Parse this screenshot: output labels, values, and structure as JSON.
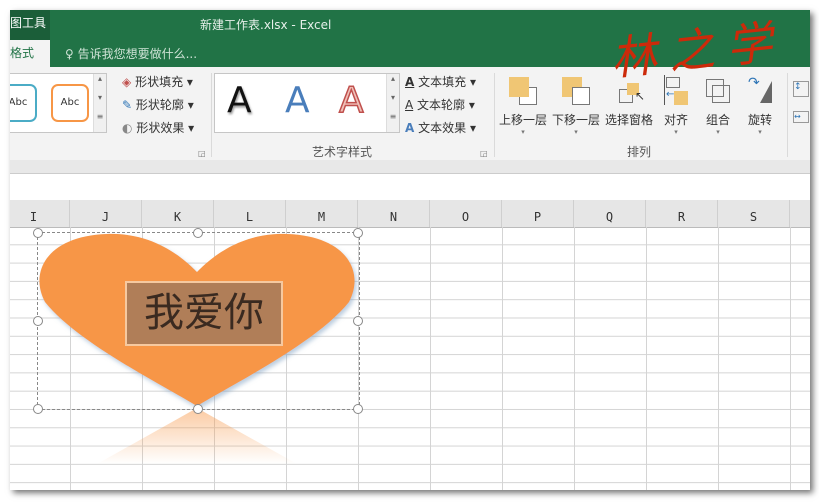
{
  "window": {
    "title": "新建工作表.xlsx - Excel",
    "context_tab": "图工具",
    "active_tab": "格式",
    "tell_me": "告诉我您想要做什么...",
    "watermark": "林之学"
  },
  "ribbon": {
    "shape_styles": {
      "gallery": [
        "Abc",
        "Abc"
      ],
      "fill": "形状填充",
      "outline": "形状轮廓",
      "effects": "形状效果"
    },
    "wordart": {
      "gallery": [
        "A",
        "A",
        "A"
      ],
      "text_fill": "文本填充",
      "text_outline": "文本轮廓",
      "text_effects": "文本效果",
      "group_label": "艺术字样式"
    },
    "arrange": {
      "bring_forward": "上移一层",
      "send_backward": "下移一层",
      "selection_pane": "选择窗格",
      "align": "对齐",
      "group": "组合",
      "rotate": "旋转",
      "group_label": "排列"
    }
  },
  "columns": [
    "I",
    "J",
    "K",
    "L",
    "M",
    "N",
    "O",
    "P",
    "Q",
    "R",
    "S"
  ],
  "shape": {
    "text": "我爱你",
    "fill": "#f79646"
  }
}
